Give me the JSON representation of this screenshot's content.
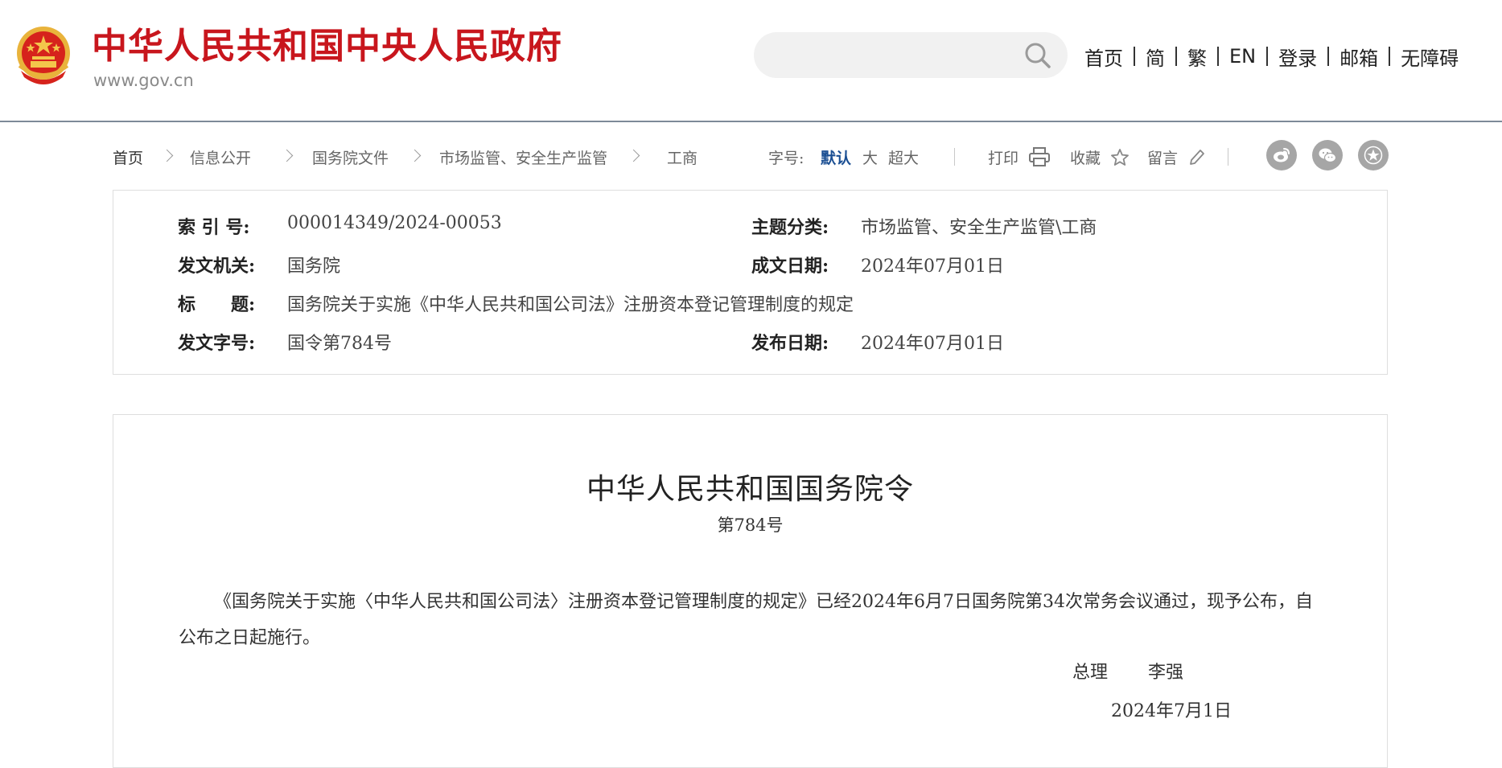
{
  "header": {
    "site_title": "中华人民共和国中央人民政府",
    "site_url": "www.gov.cn",
    "search_placeholder": "",
    "nav": [
      "首页",
      "简",
      "繁",
      "EN",
      "登录",
      "邮箱",
      "无障碍"
    ]
  },
  "breadcrumb": {
    "items": [
      "首页",
      "信息公开",
      "国务院文件",
      "市场监管、安全生产监管",
      "工商"
    ]
  },
  "font_size": {
    "label": "字号:",
    "options": [
      "默认",
      "大",
      "超大"
    ],
    "selected": "默认"
  },
  "tools": {
    "print": "打印",
    "favorite": "收藏",
    "comment": "留言"
  },
  "share_icons": [
    "weibo-icon",
    "wechat-icon",
    "party-star-icon"
  ],
  "info": {
    "index_label": "索 引 号:",
    "index_value": "000014349/2024-00053",
    "subject_label": "主题分类:",
    "subject_value": "市场监管、安全生产监管\\工商",
    "issuer_label": "发文机关:",
    "issuer_value": "国务院",
    "written_label": "成文日期:",
    "written_value": "2024年07月01日",
    "title_label": "标　　题:",
    "title_value": "国务院关于实施《中华人民共和国公司法》注册资本登记管理制度的规定",
    "docno_label": "发文字号:",
    "docno_value": "国令第784号",
    "published_label": "发布日期:",
    "published_value": "2024年07月01日"
  },
  "article": {
    "title": "中华人民共和国国务院令",
    "subtitle": "第784号",
    "body": "《国务院关于实施〈中华人民共和国公司法〉注册资本登记管理制度的规定》已经2024年6月7日国务院第34次常务会议通过，现予公布，自公布之日起施行。",
    "signer_title": "总理",
    "signer_name": "李强",
    "date": "2024年7月1日"
  },
  "colors": {
    "brand_red": "#c8161d",
    "selected_blue": "#1b4f93",
    "header_rule": "#7d8a98"
  }
}
